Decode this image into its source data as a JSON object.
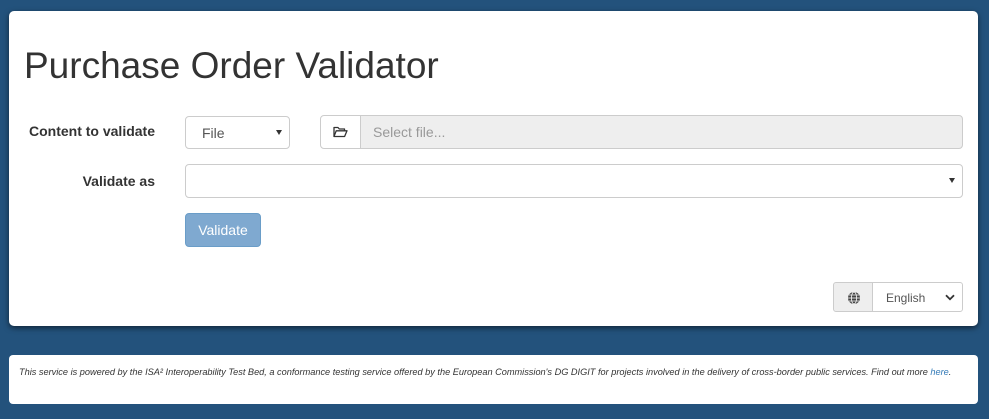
{
  "page": {
    "title": "Purchase Order Validator"
  },
  "form": {
    "content_label": "Content to validate",
    "content_type_value": "File",
    "file_placeholder": "Select file...",
    "validate_as_label": "Validate as",
    "validate_as_value": "",
    "validate_button": "Validate"
  },
  "language": {
    "selected": "English"
  },
  "footer": {
    "text": "This service is powered by the ISA² Interoperability Test Bed, a conformance testing service offered by the European Commission's DG DIGIT for projects involved in the delivery of cross-border public services. Find out more ",
    "link_text": "here",
    "suffix": "."
  },
  "icons": {
    "folder": "folder-open-icon",
    "globe": "globe-icon"
  },
  "colors": {
    "background": "#23527c",
    "button_primary": "#7fa9d0",
    "link": "#337ab7"
  }
}
